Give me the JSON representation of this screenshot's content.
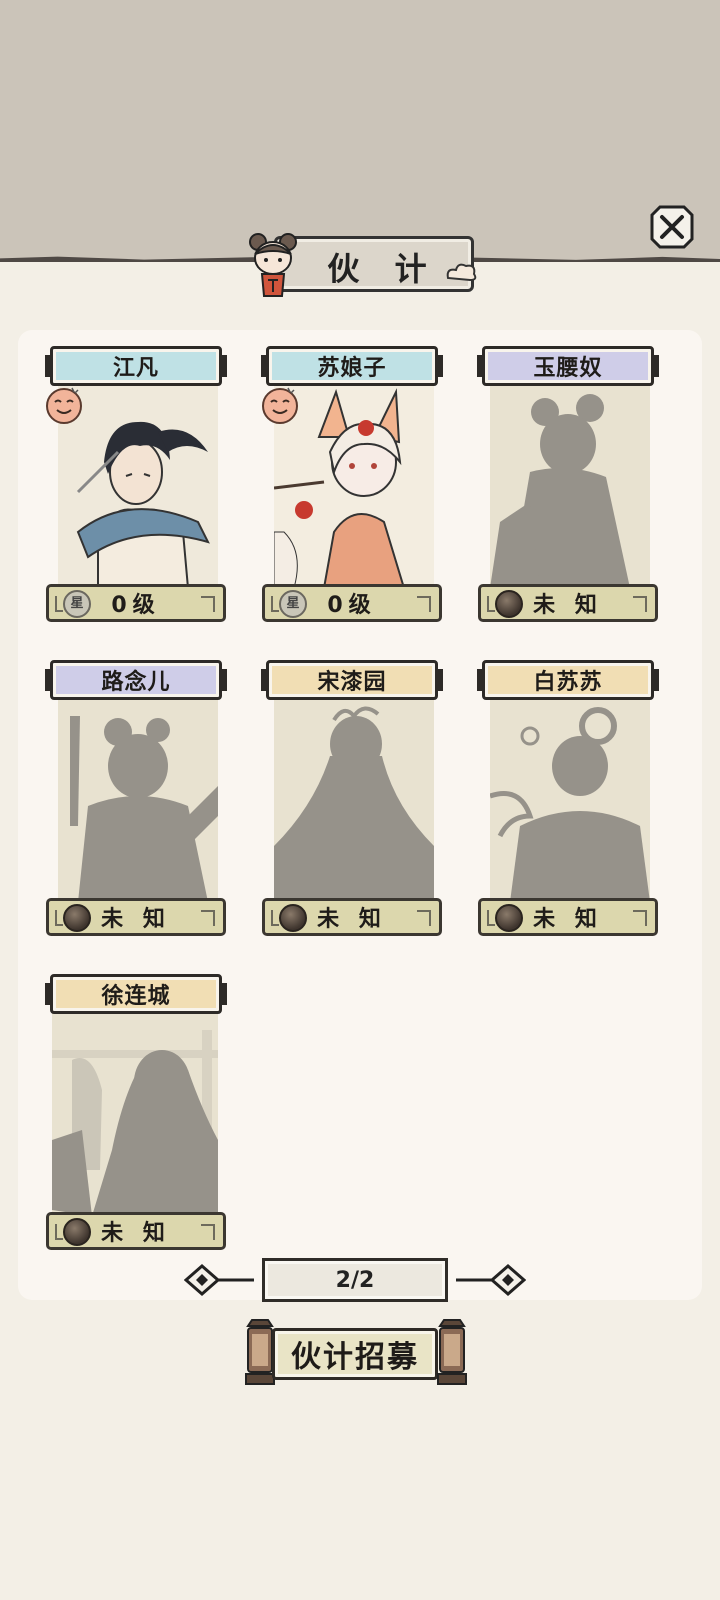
{
  "header": {
    "title": "伙 计",
    "close_icon": "close-x-icon"
  },
  "companions": [
    {
      "name": "江凡",
      "status": "0级",
      "unlocked": true,
      "plate": "blue"
    },
    {
      "name": "苏娘子",
      "status": "0级",
      "unlocked": true,
      "plate": "blue"
    },
    {
      "name": "玉腰奴",
      "status": "未 知",
      "unlocked": false,
      "plate": "purple"
    },
    {
      "name": "路念儿",
      "status": "未 知",
      "unlocked": false,
      "plate": "purple"
    },
    {
      "name": "宋漆园",
      "status": "未 知",
      "unlocked": false,
      "plate": "gold"
    },
    {
      "name": "白苏苏",
      "status": "未 知",
      "unlocked": false,
      "plate": "gold"
    },
    {
      "name": "徐连城",
      "status": "未 知",
      "unlocked": false,
      "plate": "gold"
    }
  ],
  "star_badge_text": "星",
  "pagination": {
    "label": "2/2"
  },
  "recruit": {
    "label": "伙计招募"
  },
  "colors": {
    "top_band": "#cbc4b9",
    "background": "#f3efe6",
    "panel": "#faf6f1",
    "plate_blue": "#bfe1e5",
    "plate_purple": "#cfcde8",
    "plate_gold": "#f1deb4",
    "status_bar": "#dcd7ad",
    "silhouette": "#96928a"
  }
}
